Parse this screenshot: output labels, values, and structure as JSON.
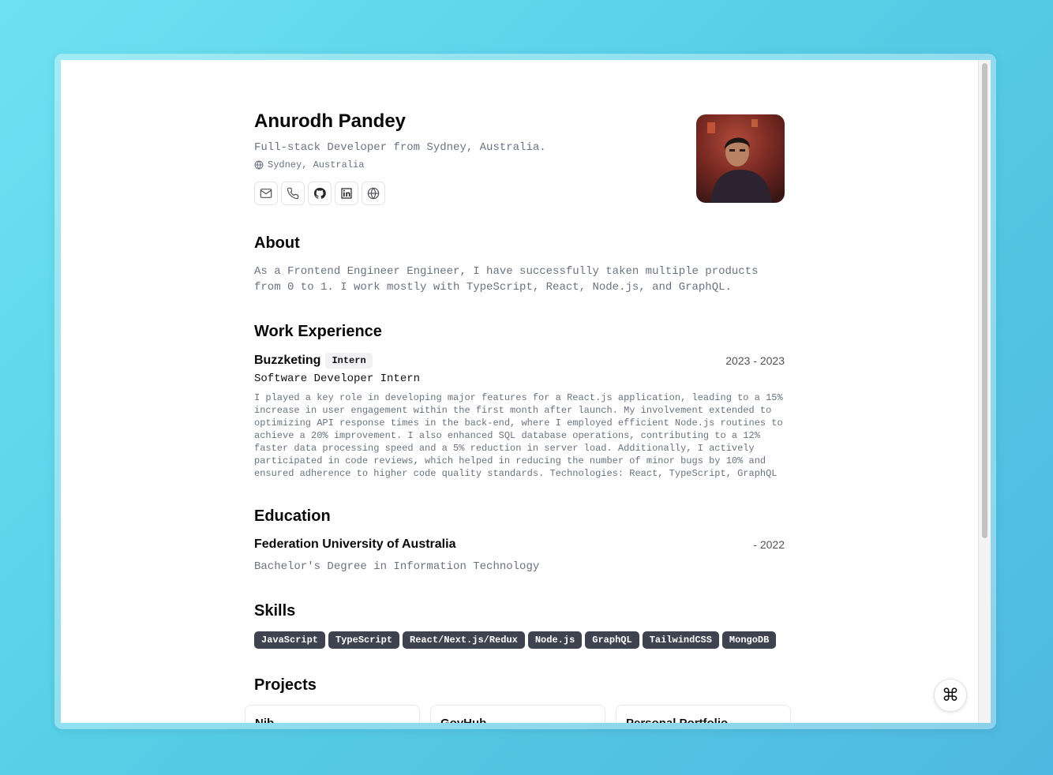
{
  "profile": {
    "name": "Anurodh Pandey",
    "tagline": "Full-stack Developer from Sydney, Australia.",
    "location": "Sydney, Australia",
    "social_icons": [
      "mail-icon",
      "phone-icon",
      "github-icon",
      "linkedin-icon",
      "globe-icon"
    ]
  },
  "about": {
    "heading": "About",
    "text": "As a Frontend Engineer Engineer, I have successfully taken multiple products from 0 to 1. I work mostly with TypeScript, React, Node.js, and GraphQL."
  },
  "work": {
    "heading": "Work Experience",
    "items": [
      {
        "company": "Buzzketing",
        "badge": "Intern",
        "dates": "2023 - 2023",
        "role": "Software Developer Intern",
        "description": "I played a key role in developing major features for a React.js application, leading to a 15% increase in user engagement within the first month after launch. My involvement extended to optimizing API response times in the back-end, where I employed efficient Node.js routines to achieve a 20% improvement. I also enhanced SQL database operations, contributing to a 12% faster data processing speed and a 5% reduction in server load. Additionally, I actively participated in code reviews, which helped in reducing the number of minor bugs by 10% and ensured adherence to higher code quality standards. Technologies: React, TypeScript, GraphQL"
      }
    ]
  },
  "education": {
    "heading": "Education",
    "items": [
      {
        "school": "Federation University of Australia",
        "dates": "- 2022",
        "degree": "Bachelor's Degree in Information Technology"
      }
    ]
  },
  "skills": {
    "heading": "Skills",
    "items": [
      "JavaScript",
      "TypeScript",
      "React/Next.js/Redux",
      "Node.js",
      "GraphQL",
      "TailwindCSS",
      "MongoDB"
    ]
  },
  "projects": {
    "heading": "Projects",
    "items": [
      "Nib...",
      "GovHub...",
      "Personal Portfolio..."
    ]
  },
  "command_button": {
    "label": "⌘"
  },
  "colors": {
    "accent_badge": "#3f4350",
    "text_muted": "#6b7280",
    "background_gradient": "#56cfe6"
  }
}
